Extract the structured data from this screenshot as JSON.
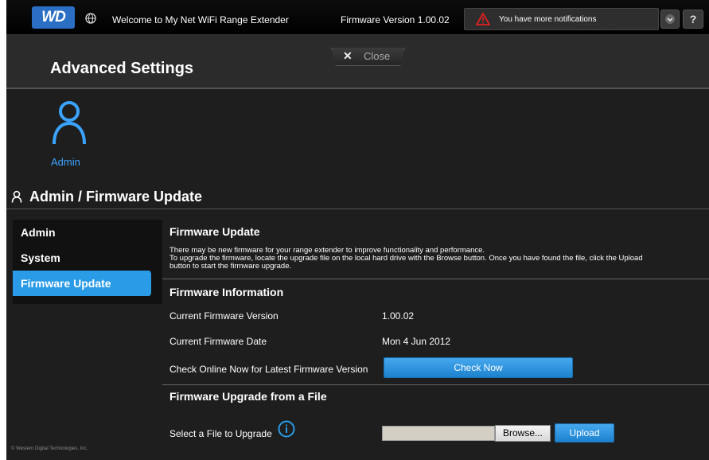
{
  "header": {
    "logo_text": "WD",
    "welcome": "Welcome to My Net WiFi Range Extender",
    "firmware_version": "Firmware Version 1.00.02",
    "notification": "You have more notifications",
    "help_label": "?"
  },
  "panel": {
    "title": "Advanced Settings",
    "close_label": "Close"
  },
  "category": {
    "label": "Admin"
  },
  "section": {
    "title": "Admin / Firmware Update"
  },
  "nav": {
    "items": [
      {
        "label": "Admin"
      },
      {
        "label": "System"
      },
      {
        "label": "Firmware Update"
      }
    ],
    "active_index": 2
  },
  "firmware_update": {
    "heading": "Firmware Update",
    "desc_line1": "There may be new firmware for your range extender to improve functionality and performance.",
    "desc_line2": "To upgrade the firmware, locate the upgrade file on the local hard drive with the Browse button. Once you have found the file, click the Upload",
    "desc_line3": "button to start the firmware upgrade."
  },
  "firmware_info": {
    "heading": "Firmware Information",
    "current_version_label": "Current Firmware Version",
    "current_version_value": "1.00.02",
    "current_date_label": "Current Firmware Date",
    "current_date_value": "Mon 4 Jun 2012",
    "check_label": "Check Online Now for Latest Firmware Version",
    "check_button": "Check Now"
  },
  "file_upgrade": {
    "heading": "Firmware Upgrade from a File",
    "select_label": "Select a File to Upgrade",
    "file_value": "",
    "browse_button": "Browse...",
    "upload_button": "Upload"
  },
  "footer": {
    "copyright": "© Western Digital Technologies, Inc."
  },
  "colors": {
    "accent": "#2a9be6",
    "background": "#1e1e1e",
    "warning": "#e02020"
  }
}
